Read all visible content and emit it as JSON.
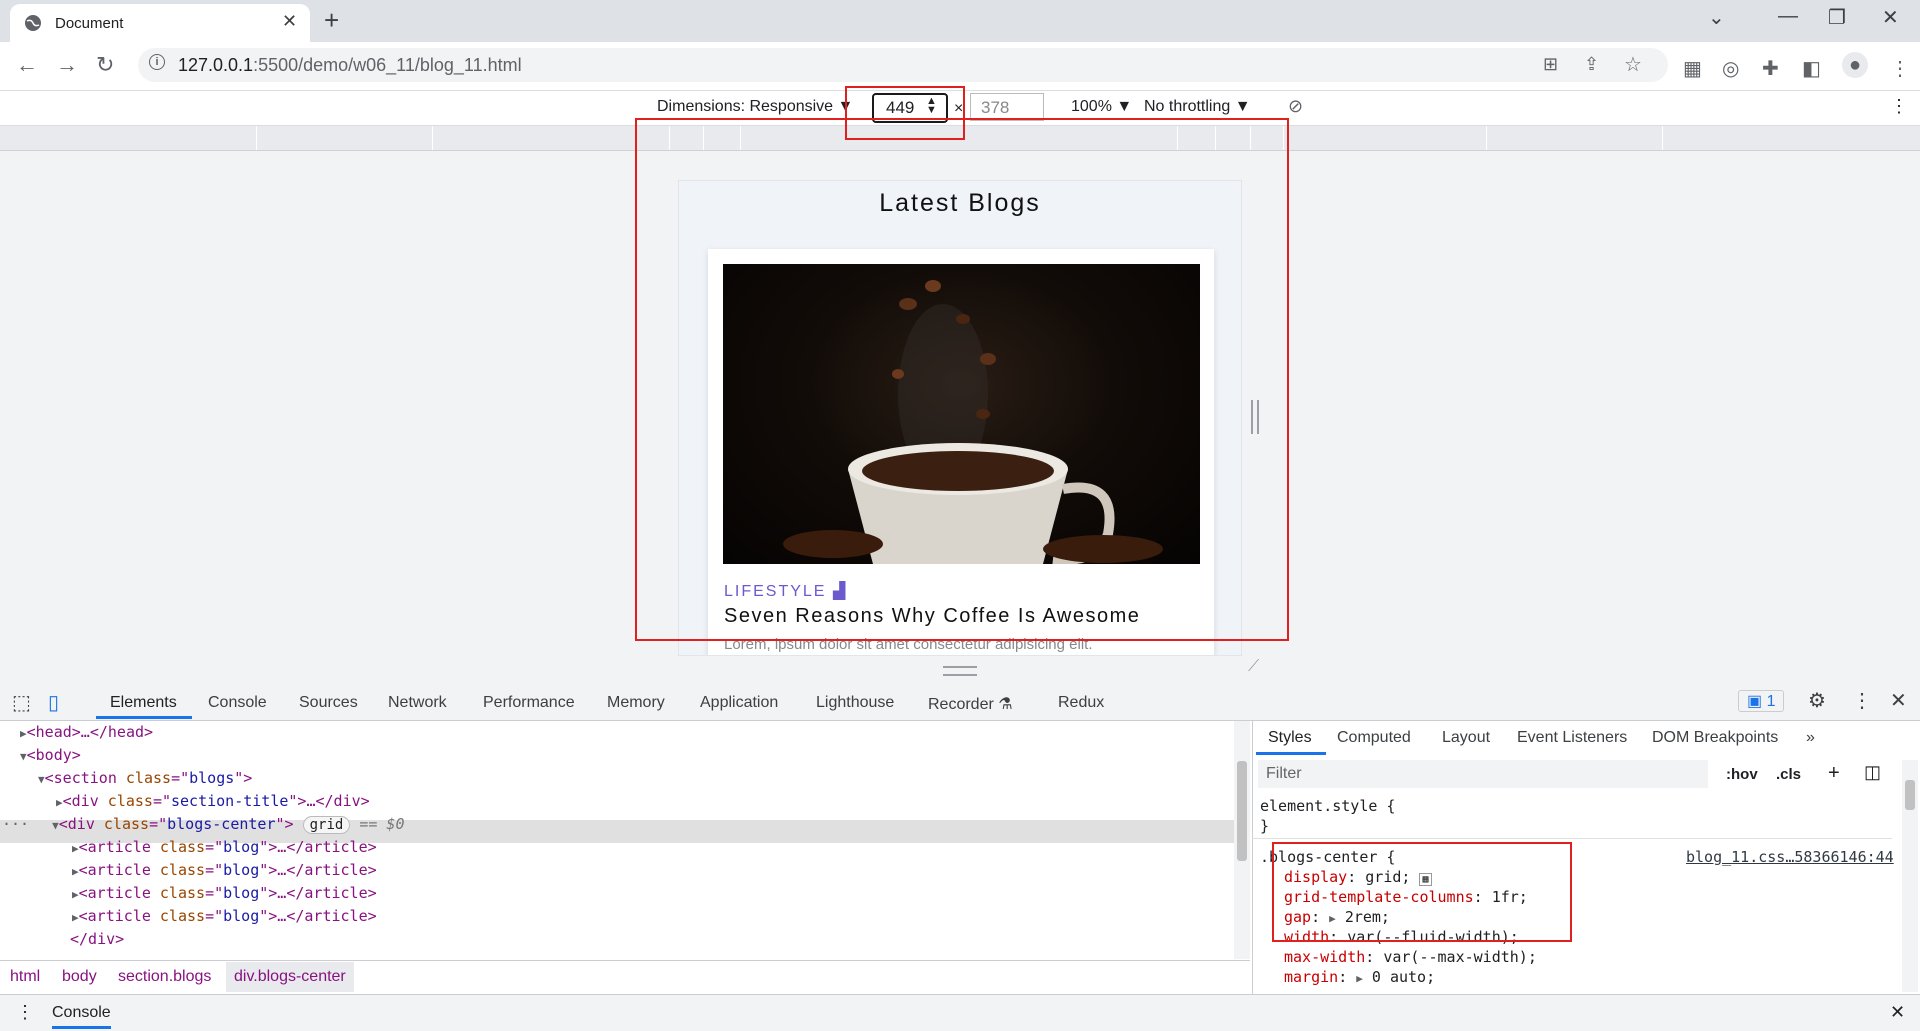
{
  "browser": {
    "tab_title": "Document",
    "url_host": "127.0.0.1",
    "url_path": ":5500/demo/w06_11/blog_11.html"
  },
  "device_toolbar": {
    "dimensions_label": "Dimensions: Responsive",
    "width_value": "449",
    "times": "×",
    "height_value": "378",
    "zoom": "100%",
    "throttling": "No throttling"
  },
  "page": {
    "title": "Latest Blogs",
    "blog": {
      "category": "LIFESTYLE",
      "title": "Seven Reasons Why Coffee Is Awesome",
      "excerpt": "Lorem, ipsum dolor sit amet consectetur adipisicing elit."
    }
  },
  "devtools": {
    "tabs": [
      "Elements",
      "Console",
      "Sources",
      "Network",
      "Performance",
      "Memory",
      "Application",
      "Lighthouse",
      "Recorder",
      "Redux"
    ],
    "issues_count": "1",
    "dom": {
      "head": "head",
      "body": "body",
      "section_class": "blogs",
      "title_div_class": "section-title",
      "center_div_class": "blogs-center",
      "grid_badge": "grid",
      "selected_marker": "== $0",
      "article_class": "blog",
      "close_div": "</div>"
    },
    "breadcrumbs": [
      "html",
      "body",
      "section.blogs",
      "div.blogs-center"
    ],
    "styles_tabs": [
      "Styles",
      "Computed",
      "Layout",
      "Event Listeners",
      "DOM Breakpoints"
    ],
    "filter_placeholder": "Filter",
    "hov": ":hov",
    "cls": ".cls",
    "element_style": "element.style {",
    "close_brace": "}",
    "rule_selector": ".blogs-center {",
    "rule_source": "blog_11.css…58366146:44",
    "rule_props": [
      {
        "name": "display",
        "value": "grid;"
      },
      {
        "name": "grid-template-columns",
        "value": "1fr;"
      },
      {
        "name": "gap",
        "value": "2rem;"
      },
      {
        "name": "width",
        "value": "var(--fluid-width);"
      },
      {
        "name": "max-width",
        "value": "var(--max-width);"
      },
      {
        "name": "margin",
        "value": "0 auto;"
      }
    ],
    "console_drawer": "Console"
  },
  "colors": {
    "annotation_red": "#e0201f",
    "accent_blue": "#1a73e8",
    "category_purple": "#6a5acd"
  }
}
